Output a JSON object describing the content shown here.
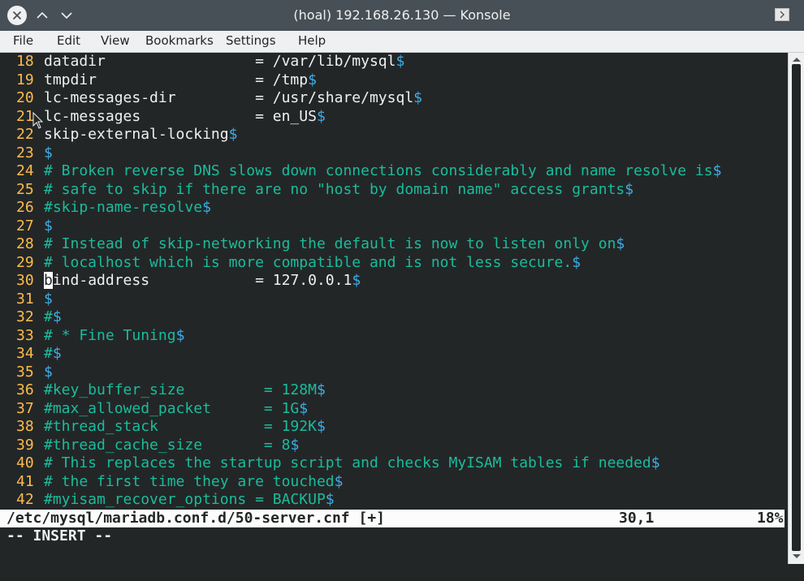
{
  "window": {
    "title": "(hoal) 192.168.26.130 — Konsole",
    "close_icon": "close-icon",
    "minimize_icon": "chevron-up-icon",
    "maximize_icon": "chevron-down-icon"
  },
  "menu": [
    "File",
    "Edit",
    "View",
    "Bookmarks",
    "Settings",
    "Help"
  ],
  "lines": [
    {
      "n": "18",
      "parts": [
        {
          "t": "datadir                 = /var/lib/mysql",
          "k": "t"
        },
        {
          "t": "$",
          "k": "d"
        }
      ]
    },
    {
      "n": "19",
      "parts": [
        {
          "t": "tmpdir                  = /tmp",
          "k": "t"
        },
        {
          "t": "$",
          "k": "d"
        }
      ]
    },
    {
      "n": "20",
      "parts": [
        {
          "t": "lc-messages-dir         = /usr/share/mysql",
          "k": "t"
        },
        {
          "t": "$",
          "k": "d"
        }
      ]
    },
    {
      "n": "21",
      "parts": [
        {
          "t": "lc-messages             = en_US",
          "k": "t"
        },
        {
          "t": "$",
          "k": "d"
        }
      ]
    },
    {
      "n": "22",
      "parts": [
        {
          "t": "skip-external-locking",
          "k": "t"
        },
        {
          "t": "$",
          "k": "d"
        }
      ]
    },
    {
      "n": "23",
      "parts": [
        {
          "t": "$",
          "k": "d"
        }
      ]
    },
    {
      "n": "24",
      "parts": [
        {
          "t": "# Broken reverse DNS slows down connections considerably and name resolve is",
          "k": "c"
        },
        {
          "t": "$",
          "k": "d"
        }
      ]
    },
    {
      "n": "25",
      "parts": [
        {
          "t": "# safe to skip if there are no \"host by domain name\" access grants",
          "k": "c"
        },
        {
          "t": "$",
          "k": "d"
        }
      ]
    },
    {
      "n": "26",
      "parts": [
        {
          "t": "#skip-name-resolve",
          "k": "c"
        },
        {
          "t": "$",
          "k": "d"
        }
      ]
    },
    {
      "n": "27",
      "parts": [
        {
          "t": "$",
          "k": "d"
        }
      ]
    },
    {
      "n": "28",
      "parts": [
        {
          "t": "# Instead of skip-networking the default is now to listen only on",
          "k": "c"
        },
        {
          "t": "$",
          "k": "d"
        }
      ]
    },
    {
      "n": "29",
      "parts": [
        {
          "t": "# localhost which is more compatible and is not less secure.",
          "k": "c"
        },
        {
          "t": "$",
          "k": "d"
        }
      ]
    },
    {
      "n": "30",
      "parts": [
        {
          "t": "b",
          "k": "cursor"
        },
        {
          "t": "ind-address            = 127.0.0.1",
          "k": "t"
        },
        {
          "t": "$",
          "k": "d"
        }
      ]
    },
    {
      "n": "31",
      "parts": [
        {
          "t": "$",
          "k": "d"
        }
      ]
    },
    {
      "n": "32",
      "parts": [
        {
          "t": "#",
          "k": "c"
        },
        {
          "t": "$",
          "k": "d"
        }
      ]
    },
    {
      "n": "33",
      "parts": [
        {
          "t": "# * Fine Tuning",
          "k": "c"
        },
        {
          "t": "$",
          "k": "d"
        }
      ]
    },
    {
      "n": "34",
      "parts": [
        {
          "t": "#",
          "k": "c"
        },
        {
          "t": "$",
          "k": "d"
        }
      ]
    },
    {
      "n": "35",
      "parts": [
        {
          "t": "$",
          "k": "d"
        }
      ]
    },
    {
      "n": "36",
      "parts": [
        {
          "t": "#key_buffer_size         = 128M",
          "k": "c"
        },
        {
          "t": "$",
          "k": "d"
        }
      ]
    },
    {
      "n": "37",
      "parts": [
        {
          "t": "#max_allowed_packet      = 1G",
          "k": "c"
        },
        {
          "t": "$",
          "k": "d"
        }
      ]
    },
    {
      "n": "38",
      "parts": [
        {
          "t": "#thread_stack            = 192K",
          "k": "c"
        },
        {
          "t": "$",
          "k": "d"
        }
      ]
    },
    {
      "n": "39",
      "parts": [
        {
          "t": "#thread_cache_size       = 8",
          "k": "c"
        },
        {
          "t": "$",
          "k": "d"
        }
      ]
    },
    {
      "n": "40",
      "parts": [
        {
          "t": "# This replaces the startup script and checks MyISAM tables if needed",
          "k": "c"
        },
        {
          "t": "$",
          "k": "d"
        }
      ]
    },
    {
      "n": "41",
      "parts": [
        {
          "t": "# the first time they are touched",
          "k": "c"
        },
        {
          "t": "$",
          "k": "d"
        }
      ]
    },
    {
      "n": "42",
      "parts": [
        {
          "t": "#myisam_recover_options = BACKUP",
          "k": "c"
        },
        {
          "t": "$",
          "k": "d"
        }
      ]
    }
  ],
  "status": {
    "file": "/etc/mysql/mariadb.conf.d/50-server.cnf [+]",
    "position": "30,1",
    "percent": "18%"
  },
  "mode": "-- INSERT --",
  "colors": {
    "background": "#232627",
    "line_number": "#fdbc4b",
    "comment": "#1abc9c",
    "eol_marker": "#3daee9",
    "text": "#eff0f1"
  }
}
